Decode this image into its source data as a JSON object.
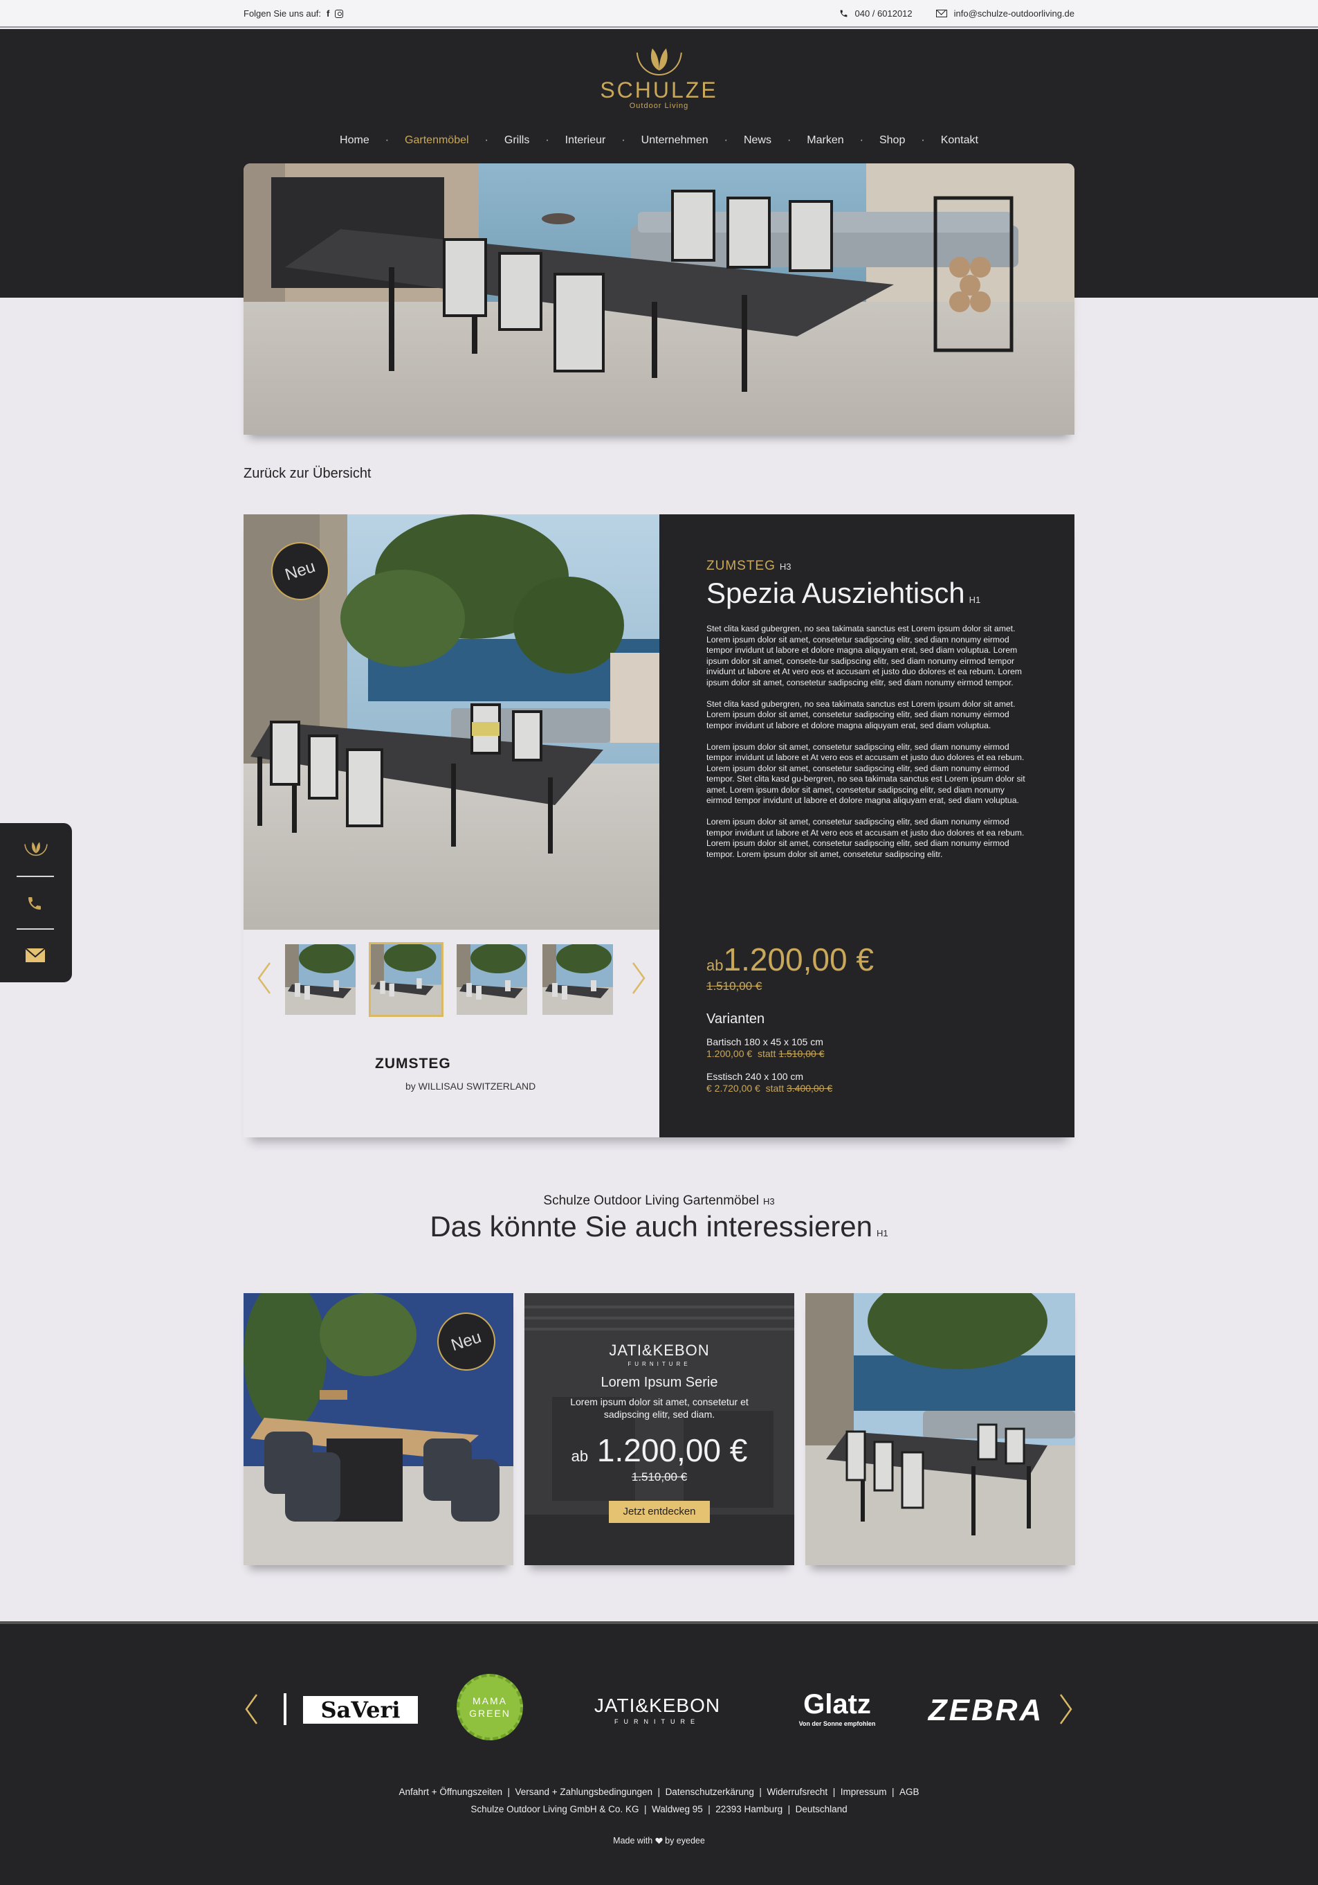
{
  "topbar": {
    "follow_label": "Folgen Sie uns auf:",
    "phone": "040 / 6012012",
    "email": "info@schulze-outdoorliving.de"
  },
  "logo": {
    "name": "SCHULZE",
    "tagline": "Outdoor Living"
  },
  "nav": {
    "items": [
      "Home",
      "Gartenmöbel",
      "Grills",
      "Interieur",
      "Unternehmen",
      "News",
      "Marken",
      "Shop",
      "Kontakt"
    ],
    "active_index": 1
  },
  "back_link": "Zurück zur Übersicht",
  "product": {
    "badge": "Neu",
    "brand_h3": "ZUMSTEG",
    "h3_tag": "H3",
    "title": "Spezia Ausziehtisch",
    "h1_tag": "H1",
    "paragraphs": [
      "Stet clita kasd gubergren, no sea takimata sanctus est Lorem ipsum dolor sit amet. Lorem ipsum dolor sit amet, consetetur sadipscing elitr, sed diam nonumy eirmod tempor invidunt ut labore et dolore magna aliquyam erat, sed diam voluptua. Lorem ipsum dolor sit amet, consete-tur sadipscing elitr, sed diam nonumy eirmod tempor invidunt ut labore et At vero eos et accusam et justo duo dolores et ea rebum. Lorem ipsum dolor sit amet, consetetur sadipscing elitr, sed diam nonumy eirmod tempor.",
      "Stet clita kasd gubergren, no sea takimata sanctus est Lorem ipsum dolor sit amet. Lorem ipsum dolor sit amet, consetetur sadipscing elitr, sed diam nonumy eirmod tempor invidunt ut labore et dolore magna aliquyam erat, sed diam voluptua.",
      "Lorem ipsum dolor sit amet, consetetur sadipscing elitr, sed diam nonumy eirmod tempor invidunt ut labore et At vero eos et accusam et justo duo dolores et ea rebum. Lorem ipsum dolor sit amet, consetetur sadipscing elitr, sed diam nonumy eirmod tempor. Stet clita kasd gu-bergren, no sea takimata sanctus est Lorem ipsum dolor sit amet. Lorem ipsum dolor sit amet, consetetur sadipscing elitr, sed diam nonumy eirmod tempor invidunt ut labore et dolore magna aliquyam erat, sed diam voluptua.",
      "Lorem ipsum dolor sit amet, consetetur sadipscing elitr, sed diam nonumy eirmod tempor invidunt ut labore et At vero eos et accusam et justo duo dolores et ea rebum. Lorem ipsum dolor sit amet, consetetur sadipscing elitr, sed diam nonumy eirmod tempor. Lorem ipsum dolor sit amet, consetetur sadipscing elitr."
    ],
    "price_prefix": "ab",
    "price": "1.200,00 €",
    "old_price": "1.510,00 €",
    "variants_title": "Varianten",
    "variants": [
      {
        "name": "Bartisch 180 x 45 x 105 cm",
        "price": "1.200,00 €",
        "statt": "statt",
        "old": "1.510,00 €"
      },
      {
        "name": "Esstisch 240 x 100 cm",
        "price": "€ 2.720,00 €",
        "statt": "statt",
        "old": "3.400,00 €"
      }
    ],
    "brand_logo": "ZUMSTEG",
    "brand_logo_sub": "by WILLISAU SWITZERLAND",
    "thumbnail_count": 4,
    "selected_thumbnail": 1
  },
  "related": {
    "subtitle": "Schulze Outdoor Living Gartenmöbel",
    "h3_tag": "H3",
    "title": "Das könnte Sie auch interessieren",
    "h1_tag": "H1",
    "card1_badge": "Neu",
    "card2": {
      "brand": "JATI&KEBON",
      "brand_sub": "FURNITURE",
      "series": "Lorem Ipsum Serie",
      "desc": "Lorem ipsum dolor sit amet, consetetur et sadipscing elitr, sed diam.",
      "price_prefix": "ab",
      "price": "1.200,00 €",
      "old_price": "1.510,00 €",
      "button": "Jetzt entdecken"
    }
  },
  "footer": {
    "brands": [
      "SaVeri",
      "MAMA GREEN",
      "JATI&KEBON",
      "FURNITURE",
      "Glatz",
      "Von der Sonne empfohlen",
      "ZEBRA"
    ],
    "links": [
      "Anfahrt + Öffnungszeiten",
      "Versand + Zahlungsbedingungen",
      "Datenschutzerkärung",
      "Widerrufsrecht",
      "Impressum",
      "AGB"
    ],
    "address": "Schulze Outdoor Living GmbH & Co. KG  |  Waldweg 95  |  22393 Hamburg  |  Deutschland",
    "made_with_prefix": "Made with",
    "made_with_suffix": "by eyedee"
  },
  "colors": {
    "gold": "#c9a85a",
    "dark": "#242427",
    "light": "#ebe9ee"
  }
}
